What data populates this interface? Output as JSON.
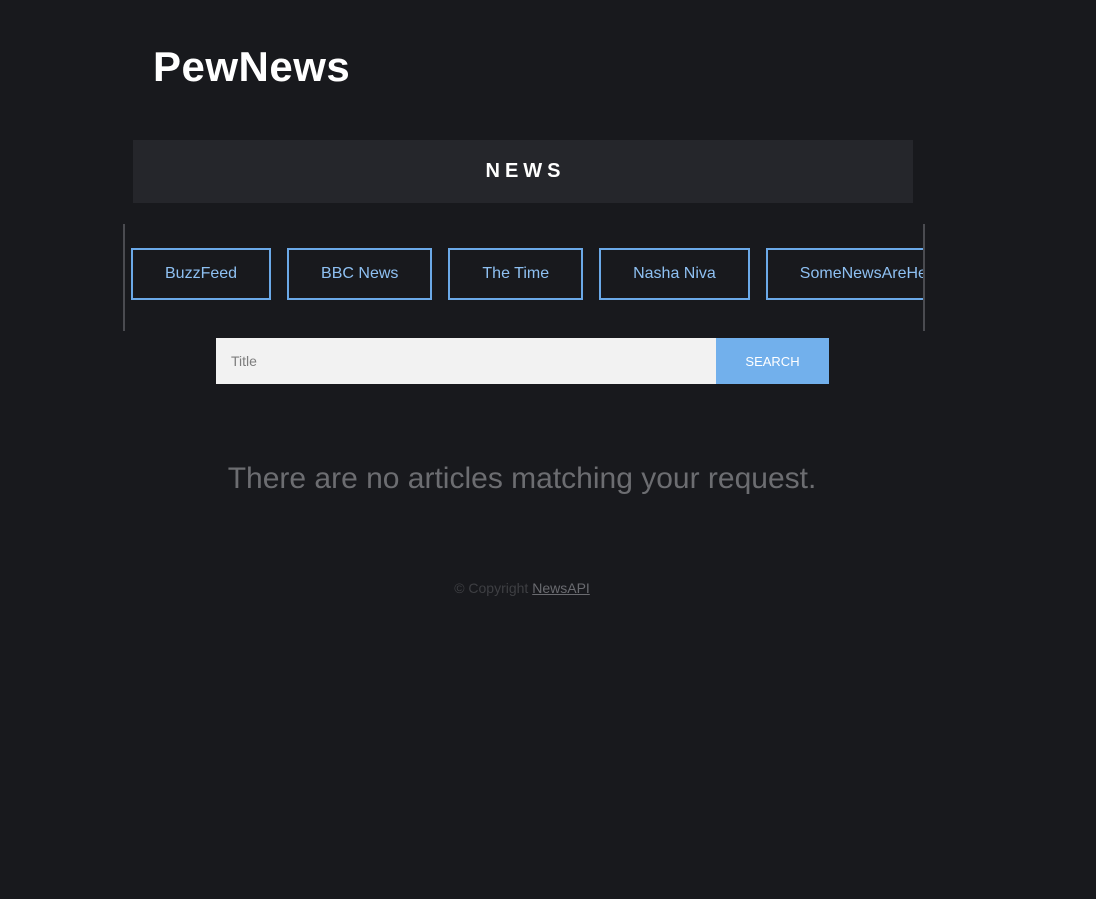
{
  "header": {
    "logo": "PewNews"
  },
  "section": {
    "title": "NEWS"
  },
  "sources": [
    {
      "label": "BuzzFeed"
    },
    {
      "label": "BBC News"
    },
    {
      "label": "The Time"
    },
    {
      "label": "Nasha Niva"
    },
    {
      "label": "SomeNewsAreHere"
    }
  ],
  "search": {
    "placeholder": "Title",
    "value": "",
    "button_label": "SEARCH"
  },
  "main": {
    "empty_message": "There are no articles matching your request."
  },
  "footer": {
    "copyright": "© Copyright ",
    "link_text": "NewsAPI"
  },
  "colors": {
    "background": "#18191d",
    "panel": "#25262b",
    "accent": "#72b0ec"
  }
}
